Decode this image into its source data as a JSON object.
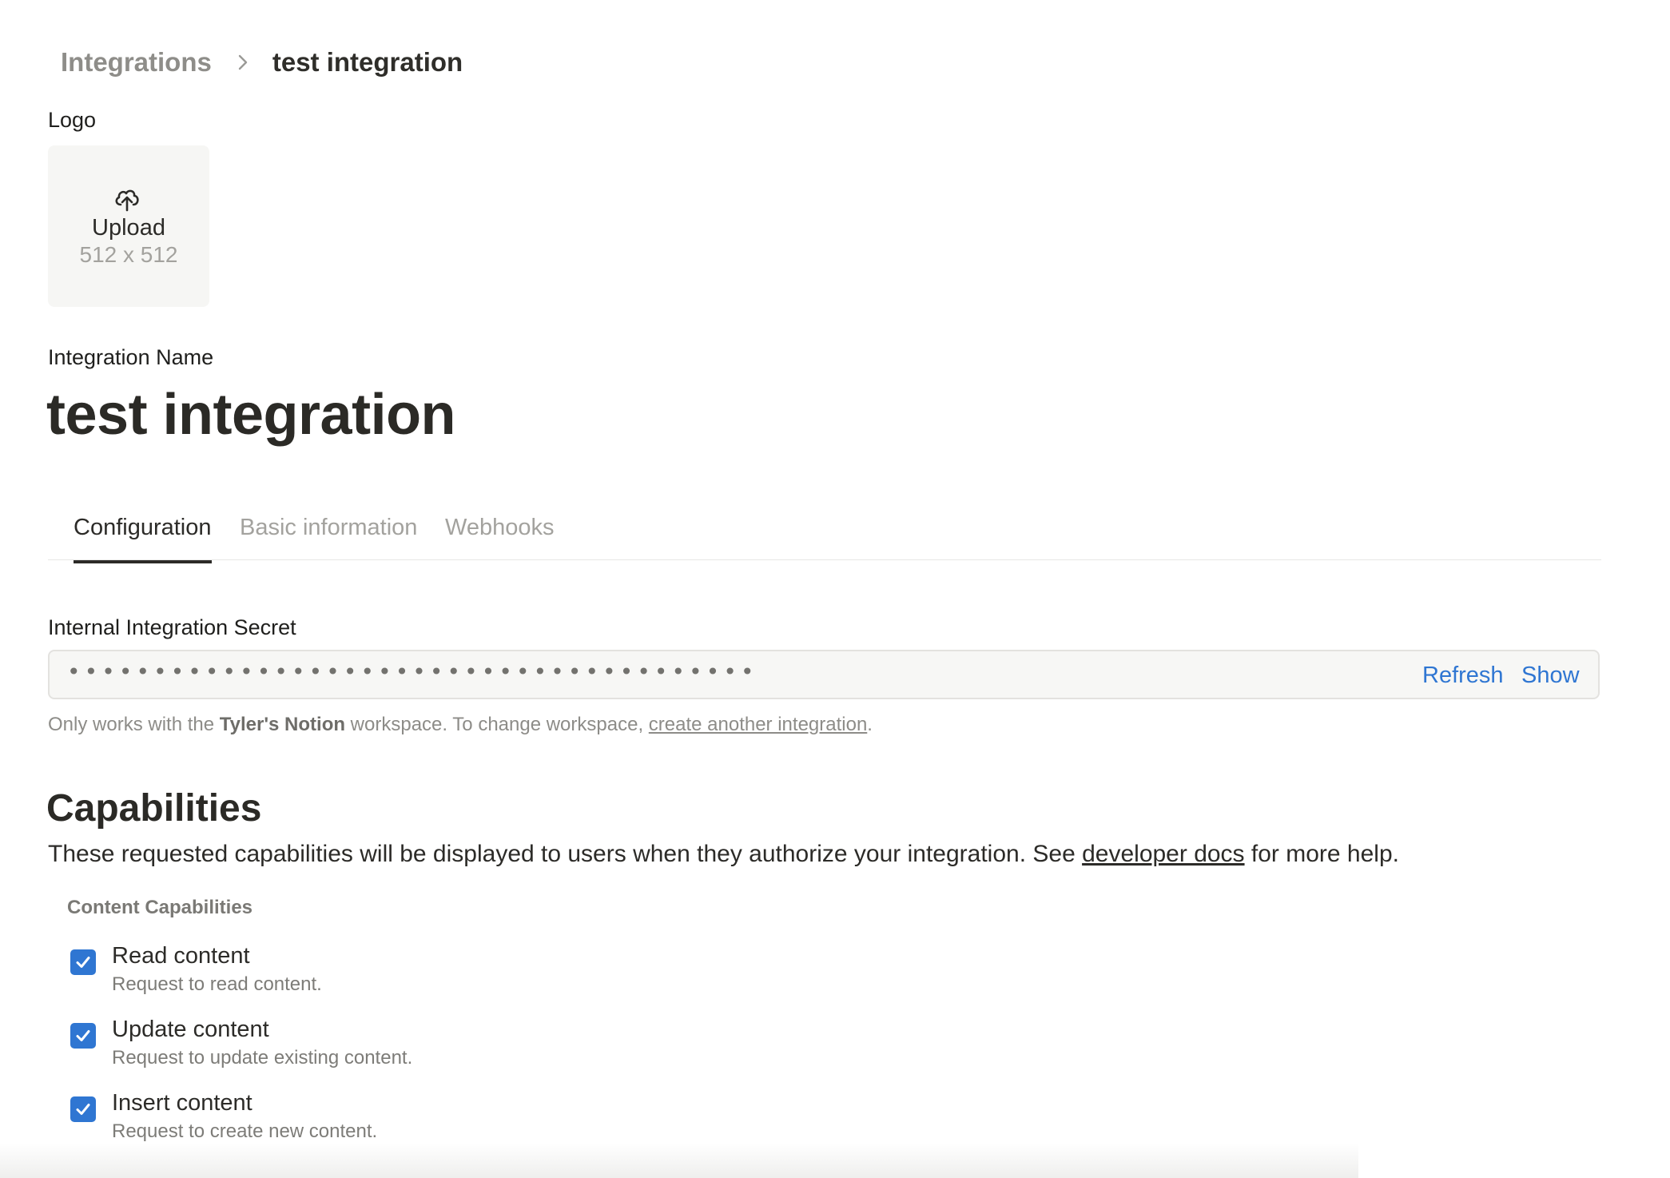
{
  "breadcrumb": {
    "root": "Integrations",
    "current": "test integration",
    "separator_icon": "chevron-right-icon"
  },
  "logo": {
    "label": "Logo",
    "upload_text": "Upload",
    "size_text": "512 x 512",
    "icon": "cloud-upload-icon"
  },
  "integration": {
    "name_label": "Integration Name",
    "name": "test integration"
  },
  "tabs": [
    {
      "label": "Configuration",
      "active": true
    },
    {
      "label": "Basic information",
      "active": false
    },
    {
      "label": "Webhooks",
      "active": false
    }
  ],
  "secret": {
    "label": "Internal Integration Secret",
    "masked_value": "••••••••••••••••••••••••••••••••••••••••",
    "refresh_label": "Refresh",
    "show_label": "Show"
  },
  "hint": {
    "prefix": "Only works with the ",
    "workspace": "Tyler's Notion",
    "middle": " workspace. To change workspace, ",
    "link": "create another integration",
    "suffix": "."
  },
  "capabilities": {
    "heading": "Capabilities",
    "desc_prefix": "These requested capabilities will be displayed to users when they authorize your integration. See ",
    "desc_link": "developer docs",
    "desc_suffix": " for more help.",
    "group_label": "Content Capabilities",
    "items": [
      {
        "title": "Read content",
        "desc": "Request to read content.",
        "checked": true
      },
      {
        "title": "Update content",
        "desc": "Request to update existing content.",
        "checked": true
      },
      {
        "title": "Insert content",
        "desc": "Request to create new content.",
        "checked": true
      }
    ]
  },
  "colors": {
    "accent": "#2f76d2",
    "text": "#37352f",
    "muted": "#8d8c88"
  }
}
